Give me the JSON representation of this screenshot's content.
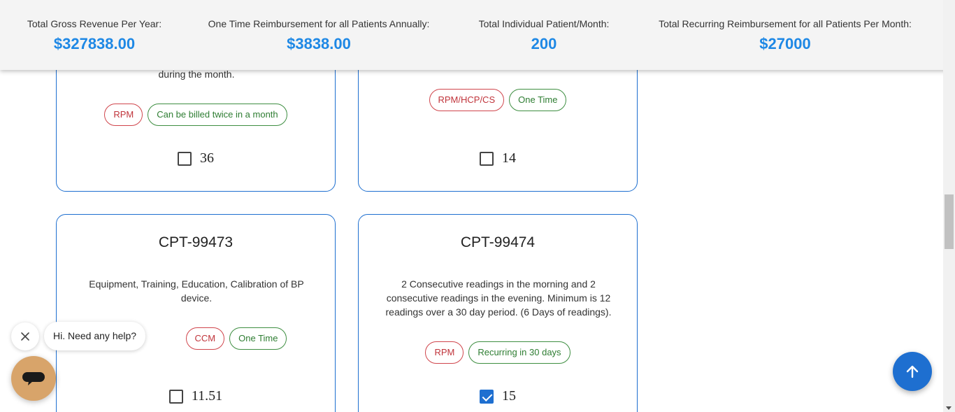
{
  "stats": [
    {
      "label": "Total Gross Revenue Per Year:",
      "value": "$327838.00"
    },
    {
      "label": "One Time Reimbursement for all Patients Annually:",
      "value": "$3838.00"
    },
    {
      "label": "Total Individual Patient/Month:",
      "value": "200"
    },
    {
      "label": "Total Recurring Reimbursement for all Patients Per Month:",
      "value": "$27000"
    }
  ],
  "cards": [
    {
      "desc_fragment": "during the month.",
      "tags": [
        {
          "text": "RPM",
          "color": "red"
        },
        {
          "text": "Can be billed twice in a month",
          "color": "green"
        }
      ],
      "price": "36",
      "checked": false
    },
    {
      "tags": [
        {
          "text": "RPM/HCP/CS",
          "color": "red"
        },
        {
          "text": "One Time",
          "color": "green"
        }
      ],
      "price": "14",
      "checked": false
    },
    {
      "title": "CPT-99473",
      "desc": "Equipment, Training, Education, Calibration of BP device.",
      "tags": [
        {
          "text": "CCM",
          "color": "red"
        },
        {
          "text": "One Time",
          "color": "green"
        }
      ],
      "price": "11.51",
      "checked": false
    },
    {
      "title": "CPT-99474",
      "desc": "2 Consecutive readings in the morning and 2 consecutive readings in the evening. Minimum is 12 readings over a 30 day period. (6 Days of readings).",
      "tags": [
        {
          "text": "RPM",
          "color": "red"
        },
        {
          "text": "Recurring in 30 days",
          "color": "green"
        }
      ],
      "price": "15",
      "checked": true
    }
  ],
  "chat": {
    "greeting": "Hi. Need any help?"
  },
  "colors": {
    "accent": "#1e6fd0",
    "stat_value": "#1e88e5",
    "tag_red": "#c0343b",
    "tag_green": "#2e7d32",
    "chat_launcher": "#d8a46a"
  },
  "icons": {
    "close": "close-icon",
    "chat": "chat-icon",
    "scroll_top": "arrow-up-icon"
  }
}
